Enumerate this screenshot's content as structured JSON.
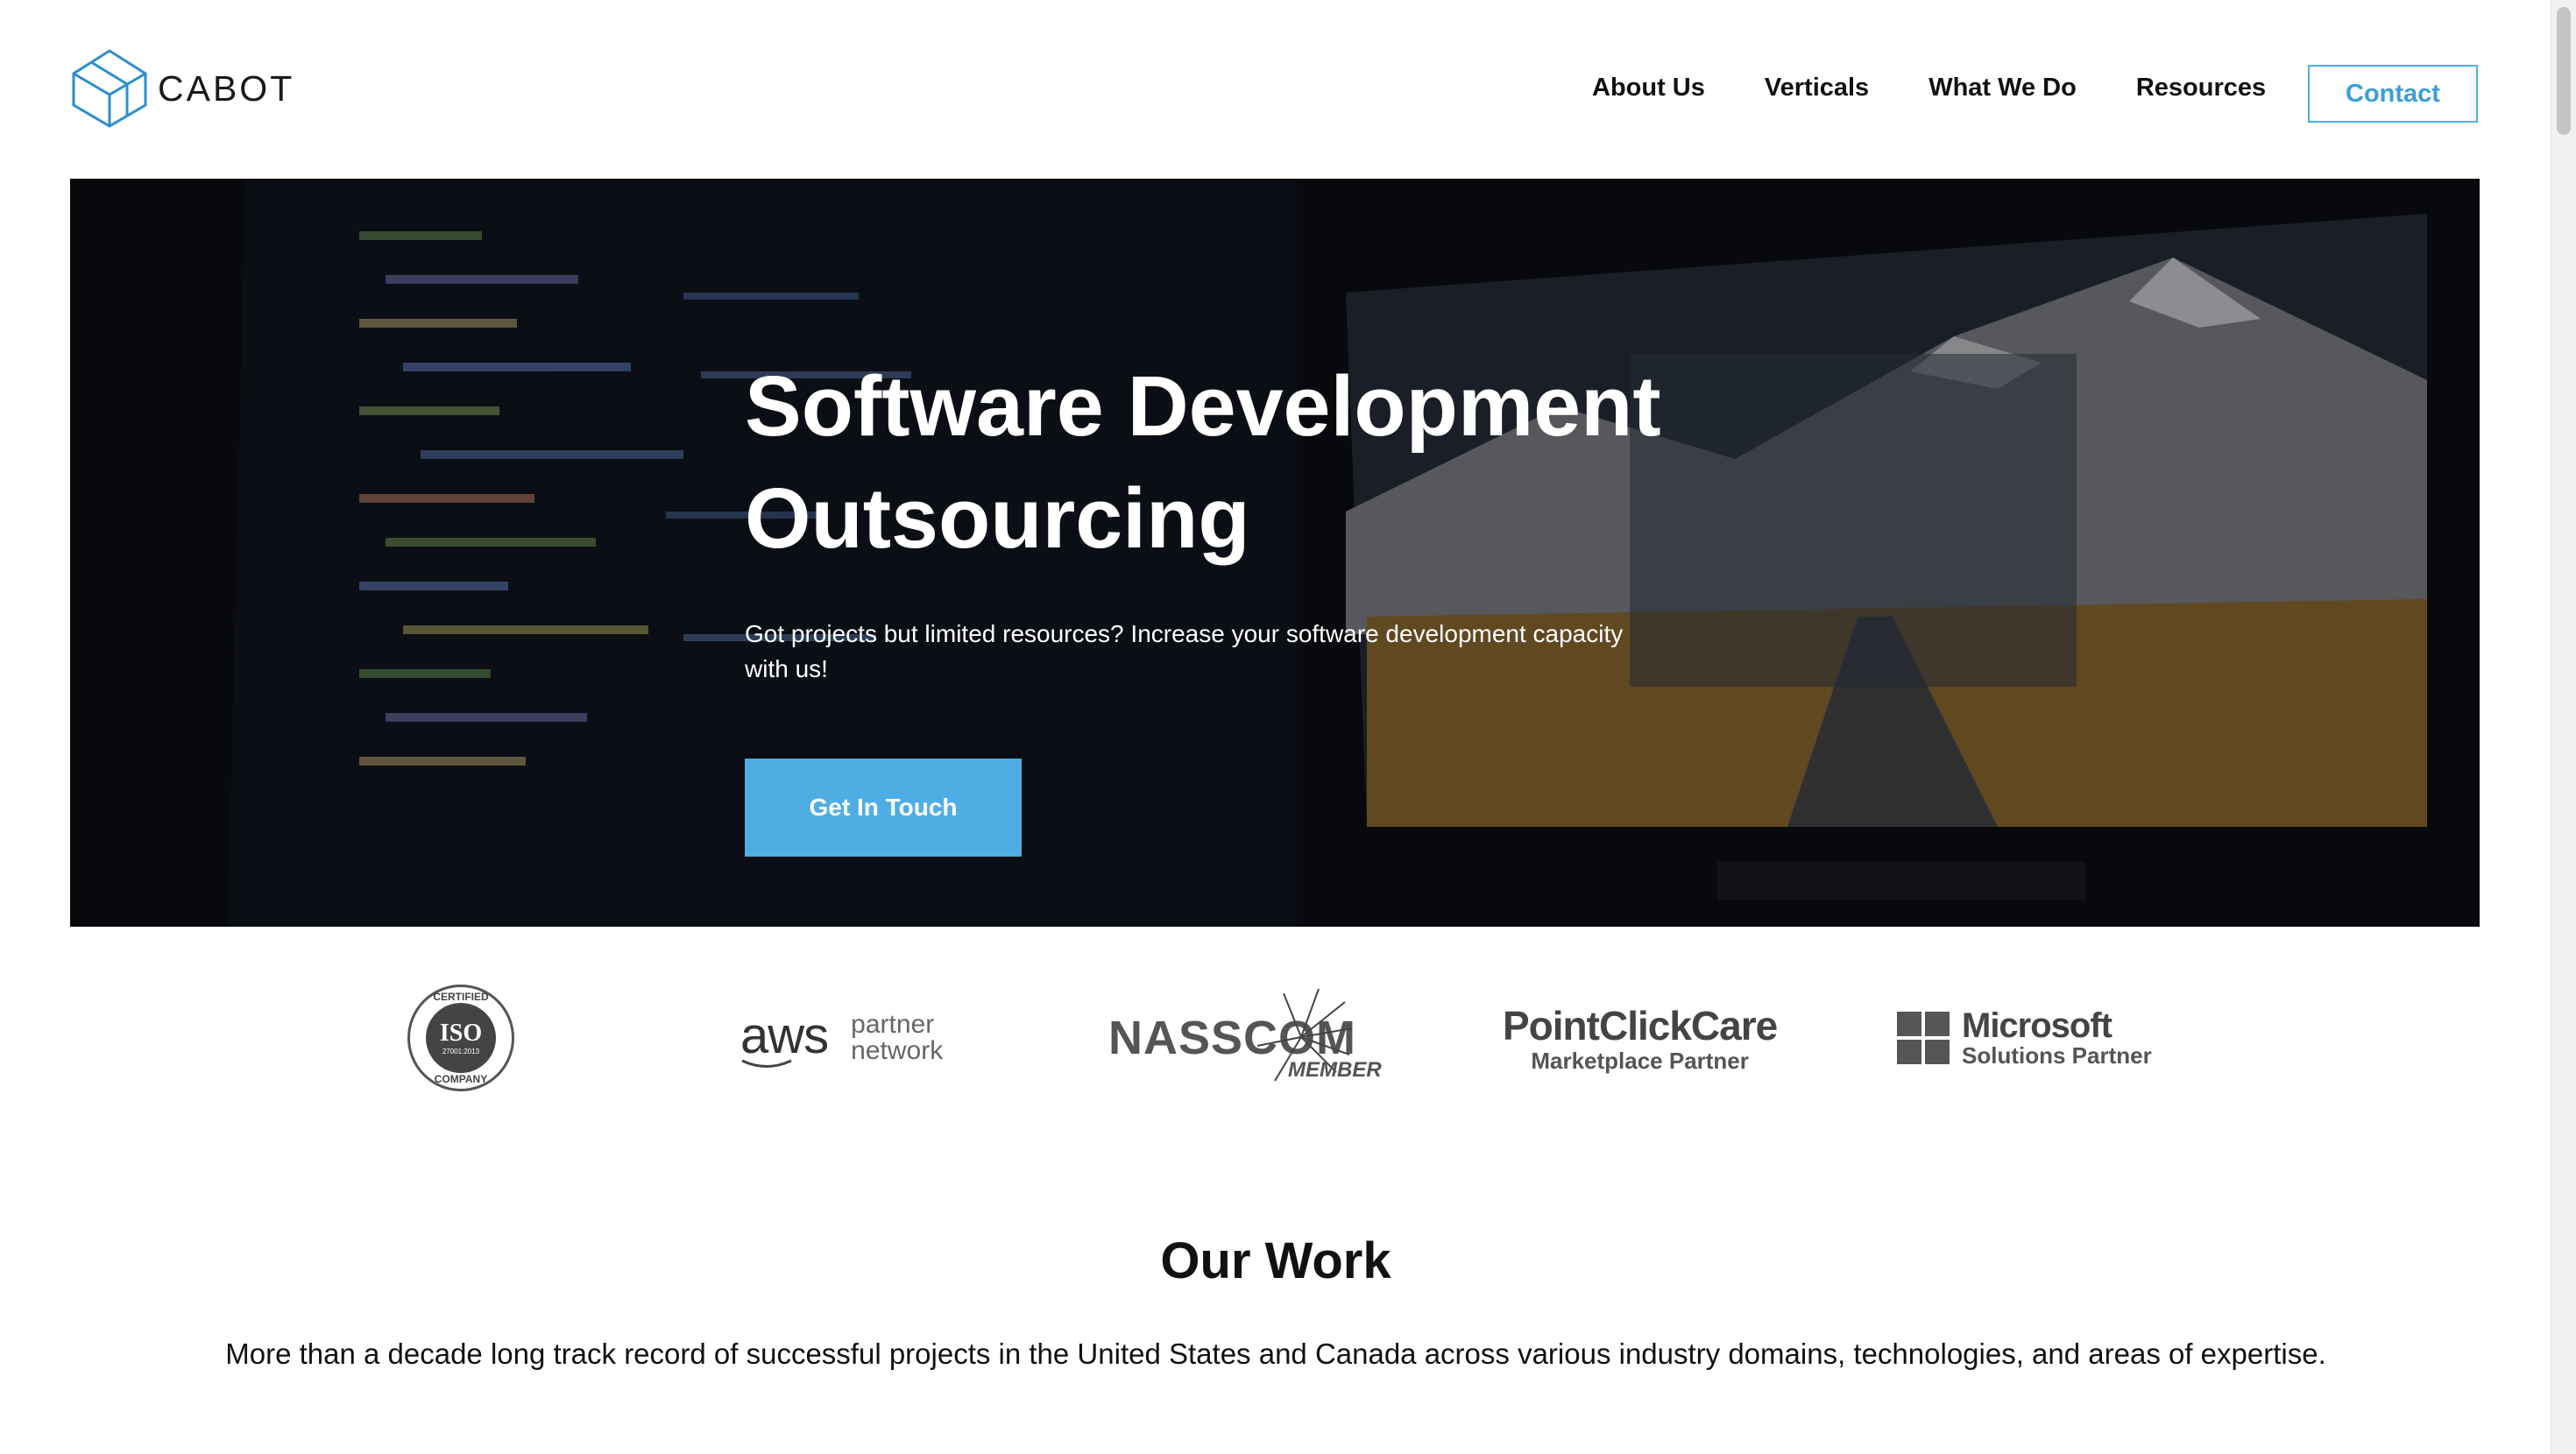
{
  "header": {
    "logo_text": "CABOT",
    "nav": [
      "About Us",
      "Verticals",
      "What We Do",
      "Resources"
    ],
    "contact_label": "Contact"
  },
  "hero": {
    "title_line1": "Software Development",
    "title_line2": "Outsourcing",
    "subtitle": "Got projects but limited resources? Increase your software development capacity with us!",
    "cta_label": "Get In Touch"
  },
  "partners": {
    "iso": {
      "top": "CERTIFIED",
      "main": "ISO",
      "num": "27001:2013",
      "bottom": "COMPANY"
    },
    "aws": {
      "main": "aws",
      "line1": "partner",
      "line2": "network"
    },
    "nasscom": {
      "main": "NASSCOM",
      "sub": "MEMBER"
    },
    "pointclickcare": {
      "main": "PointClickCare",
      "sub": "Marketplace Partner"
    },
    "microsoft": {
      "main": "Microsoft",
      "sub": "Solutions Partner"
    }
  },
  "work": {
    "title": "Our Work",
    "text": "More than a decade long track record of successful projects in the United States and Canada across various industry domains, technologies, and areas of expertise."
  },
  "colors": {
    "accent": "#4eaee3",
    "text": "#111111"
  }
}
